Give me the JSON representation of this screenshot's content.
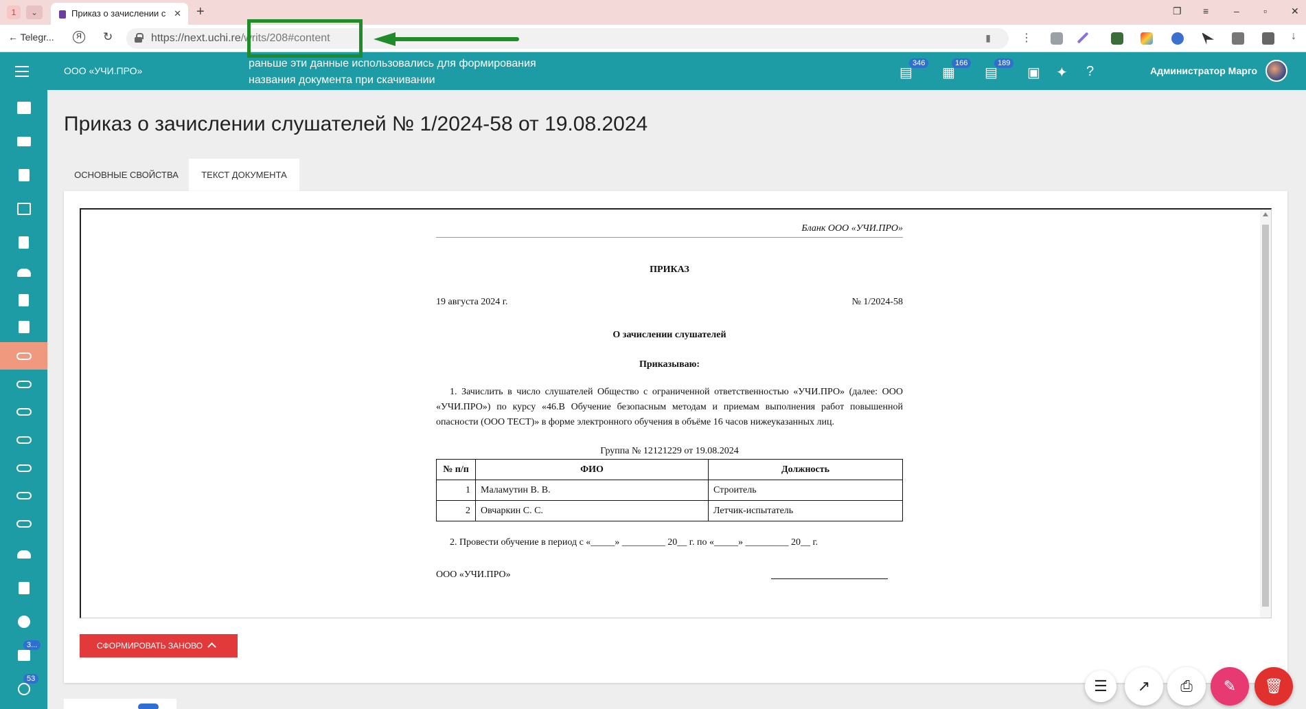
{
  "browser": {
    "tab_counter": "1",
    "tab_title": "Приказ о зачислении с",
    "url_host": "https://next.uchi.re",
    "url_path": "/writs/208#content",
    "back_label": "Telegr..."
  },
  "annotation": {
    "text_line1": "раньше эти данные использовались для формирования",
    "text_line2": "названия документа при скачивании",
    "color": "#1f8c29"
  },
  "header": {
    "org_name": "ООО «УЧИ.ПРО»",
    "badges": {
      "messages": "346",
      "documents": "166",
      "tasks": "189"
    },
    "user_name": "Администратор Марго",
    "color": "#1d9ca5"
  },
  "sidebar": {
    "badges": {
      "chat": "3...",
      "support": "53"
    },
    "active_color": "#f0997f"
  },
  "page": {
    "title": "Приказ о зачислении слушателей № 1/2024-58 от 19.08.2024",
    "tabs": [
      {
        "label": "ОСНОВНЫЕ СВОЙСТВА"
      },
      {
        "label": "ТЕКСТ ДОКУМЕНТА"
      }
    ],
    "regen_button": "СФОРМИРОВАТЬ ЗАНОВО"
  },
  "document": {
    "blank": "Бланк ООО «УЧИ.ПРО»",
    "title": "ПРИКАЗ",
    "date": "19 августа 2024 г.",
    "number": "№ 1/2024-58",
    "subject": "О зачислении слушателей",
    "order": "Приказываю:",
    "para1": "1.  Зачислить в число слушателей Общество с ограниченной ответственностью «УЧИ.ПРО» (далее: ООО «УЧИ.ПРО») по курсу «46.В Обучение безопасным методам и приемам выполнения работ повышенной опасности (ООО ТЕСТ)» в форме электронного обучения в объёме 16 часов нижеуказанных лиц.",
    "group": "Группа № 12121229 от 19.08.2024",
    "table": {
      "headers": [
        "№ п/п",
        "ФИО",
        "Должность"
      ],
      "rows": [
        [
          "1",
          "Маламутин В. В.",
          "Строитель"
        ],
        [
          "2",
          "Овчаркин С. С.",
          "Летчик-испытатель"
        ]
      ]
    },
    "para2": "2.  Провести обучение в период с «_____» _________ 20__ г. по «_____» _________ 20__ г.",
    "org": "ООО «УЧИ.ПРО»"
  }
}
